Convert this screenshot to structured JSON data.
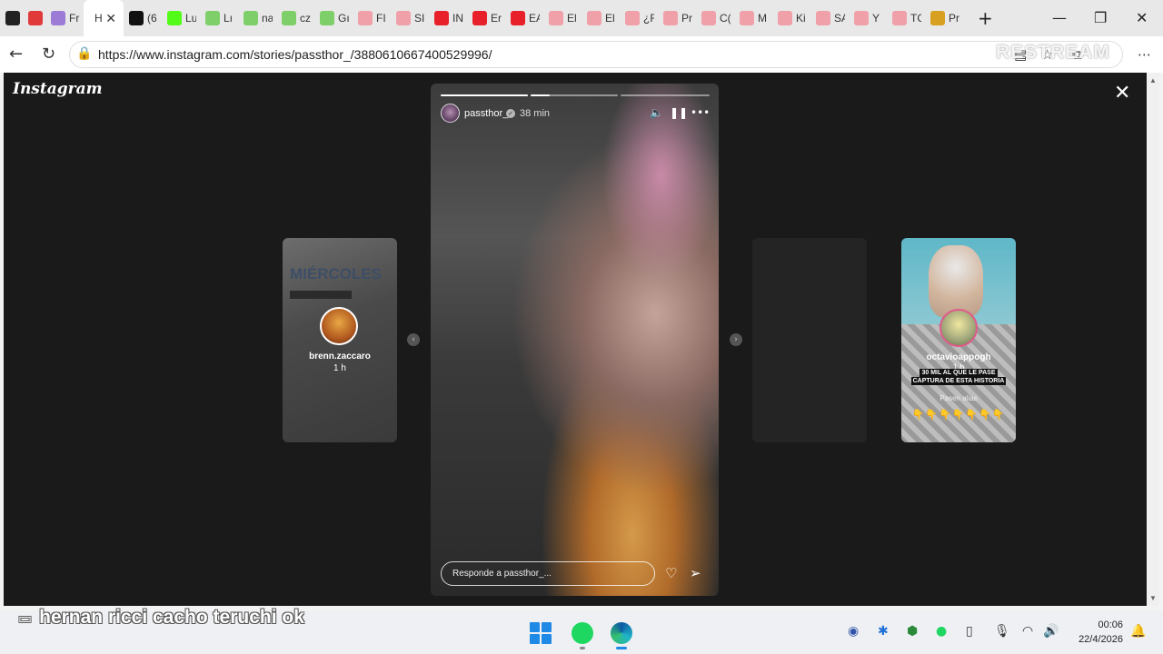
{
  "browser": {
    "tabs": [
      {
        "label": "",
        "icon": "record-icon",
        "color": "#222222"
      },
      {
        "label": "",
        "icon": "red-dot-icon",
        "color": "#e03a3a"
      },
      {
        "label": "Fr",
        "icon": "app-icon",
        "color": "#9b7bd6"
      },
      {
        "label": "Hi",
        "icon": "",
        "color": "#ffffff",
        "active": true
      },
      {
        "label": "(6",
        "icon": "x-icon",
        "color": "#111111"
      },
      {
        "label": "Lu",
        "icon": "kick-icon",
        "color": "#53fc18"
      },
      {
        "label": "Lı",
        "icon": "kick-icon",
        "color": "#7ecf6a"
      },
      {
        "label": "na",
        "icon": "kick-icon",
        "color": "#7ecf6a"
      },
      {
        "label": "cz",
        "icon": "kick-icon",
        "color": "#7ecf6a"
      },
      {
        "label": "Gı",
        "icon": "kick-icon",
        "color": "#7ecf6a"
      },
      {
        "label": "FI",
        "icon": "youtube-icon",
        "color": "#f0a0a8"
      },
      {
        "label": "SI",
        "icon": "youtube-icon",
        "color": "#f0a0a8"
      },
      {
        "label": "IN",
        "icon": "youtube-icon",
        "color": "#e8202a"
      },
      {
        "label": "Er",
        "icon": "youtube-icon",
        "color": "#e8202a"
      },
      {
        "label": "EA",
        "icon": "youtube-icon",
        "color": "#e8202a"
      },
      {
        "label": "El",
        "icon": "youtube-icon",
        "color": "#f0a0a8"
      },
      {
        "label": "El",
        "icon": "youtube-icon",
        "color": "#f0a0a8"
      },
      {
        "label": "¿F",
        "icon": "youtube-icon",
        "color": "#f0a0a8"
      },
      {
        "label": "Pr",
        "icon": "youtube-icon",
        "color": "#f0a0a8"
      },
      {
        "label": "C(",
        "icon": "youtube-icon",
        "color": "#f0a0a8"
      },
      {
        "label": "M",
        "icon": "youtube-icon",
        "color": "#f0a0a8"
      },
      {
        "label": "Ki",
        "icon": "youtube-icon",
        "color": "#f0a0a8"
      },
      {
        "label": "SA",
        "icon": "youtube-icon",
        "color": "#f0a0a8"
      },
      {
        "label": "Y",
        "icon": "youtube-icon",
        "color": "#f0a0a8"
      },
      {
        "label": "TC",
        "icon": "youtube-icon",
        "color": "#f0a0a8"
      },
      {
        "label": "Pr",
        "icon": "extension-icon",
        "color": "#d8a020"
      }
    ],
    "close_tab": "✕",
    "new_tab": "+",
    "url": "https://www.instagram.com/stories/passthor_/3880610667400529996/",
    "watermark": "RESTREAM"
  },
  "instagram": {
    "logo": "Instagram",
    "close": "✕",
    "prev_story": {
      "username": "brenn.zaccaro",
      "time": "1 h",
      "headline": "MIÉRCOLES"
    },
    "next_story": {
      "username": "octavioappogh",
      "time": "1 h",
      "caption_line1": "30 MIL AL QUE LE PASE",
      "caption_line2": "CAPTURA DE ESTA HISTORIA",
      "caption_alias": "Pasen alias",
      "emojis": "👇👇👇👇👇👇👇"
    },
    "story": {
      "username": "passthor_",
      "time": "38 min",
      "progress": [
        1.0,
        0.22,
        0.0
      ],
      "reply_placeholder": "Responde a passthor_..."
    }
  },
  "taskbar": {
    "chat_overlay": "hernan ricci cacho teruchi ok",
    "time": "00:06",
    "date": "22/4/2026"
  }
}
